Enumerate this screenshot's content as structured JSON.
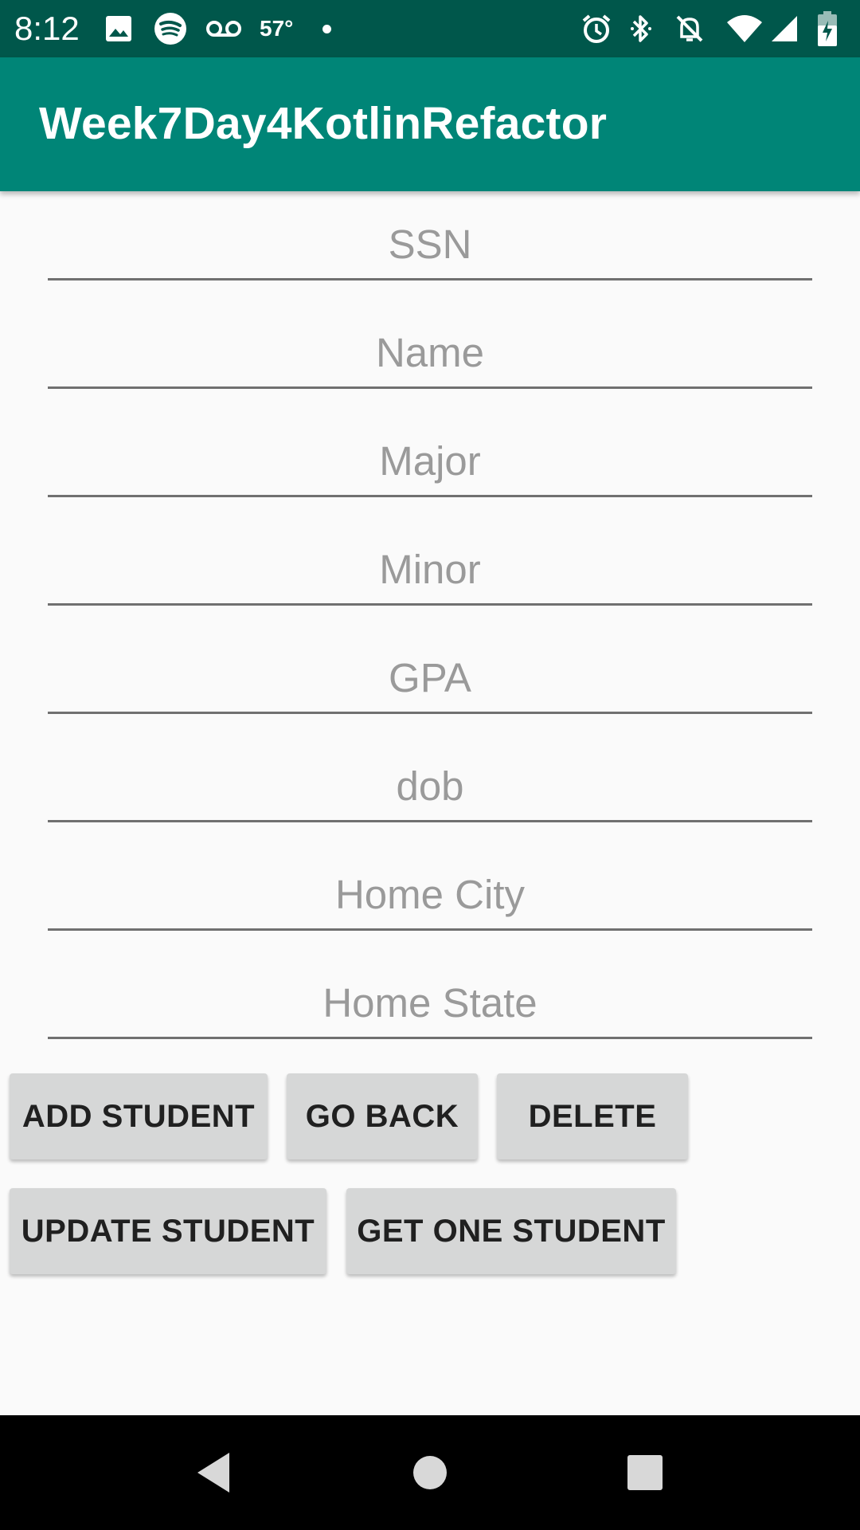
{
  "status_bar": {
    "time": "8:12",
    "temperature": "57°",
    "icons_left": [
      "image-icon",
      "spotify-icon",
      "voicemail-icon"
    ],
    "icons_right": [
      "alarm-icon",
      "bluetooth-icon",
      "do-not-disturb-icon",
      "wifi-icon",
      "signal-icon",
      "battery-charging-icon"
    ]
  },
  "app_bar": {
    "title": "Week7Day4KotlinRefactor"
  },
  "form": {
    "fields": [
      {
        "placeholder": "SSN",
        "value": ""
      },
      {
        "placeholder": "Name",
        "value": ""
      },
      {
        "placeholder": "Major",
        "value": ""
      },
      {
        "placeholder": "Minor",
        "value": ""
      },
      {
        "placeholder": "GPA",
        "value": ""
      },
      {
        "placeholder": "dob",
        "value": ""
      },
      {
        "placeholder": "Home City",
        "value": ""
      },
      {
        "placeholder": "Home State",
        "value": ""
      }
    ]
  },
  "buttons": {
    "add_student": "ADD STUDENT",
    "go_back": "GO BACK",
    "delete": "DELETE",
    "update_student": "UPDATE STUDENT",
    "get_one_student": "GET ONE STUDENT"
  },
  "nav_bar": {
    "icons": [
      "back-icon",
      "home-icon",
      "recents-icon"
    ]
  },
  "colors": {
    "status_bar": "#00574b",
    "app_bar": "#008577",
    "background": "#fafafa",
    "button": "#d6d7d7"
  }
}
